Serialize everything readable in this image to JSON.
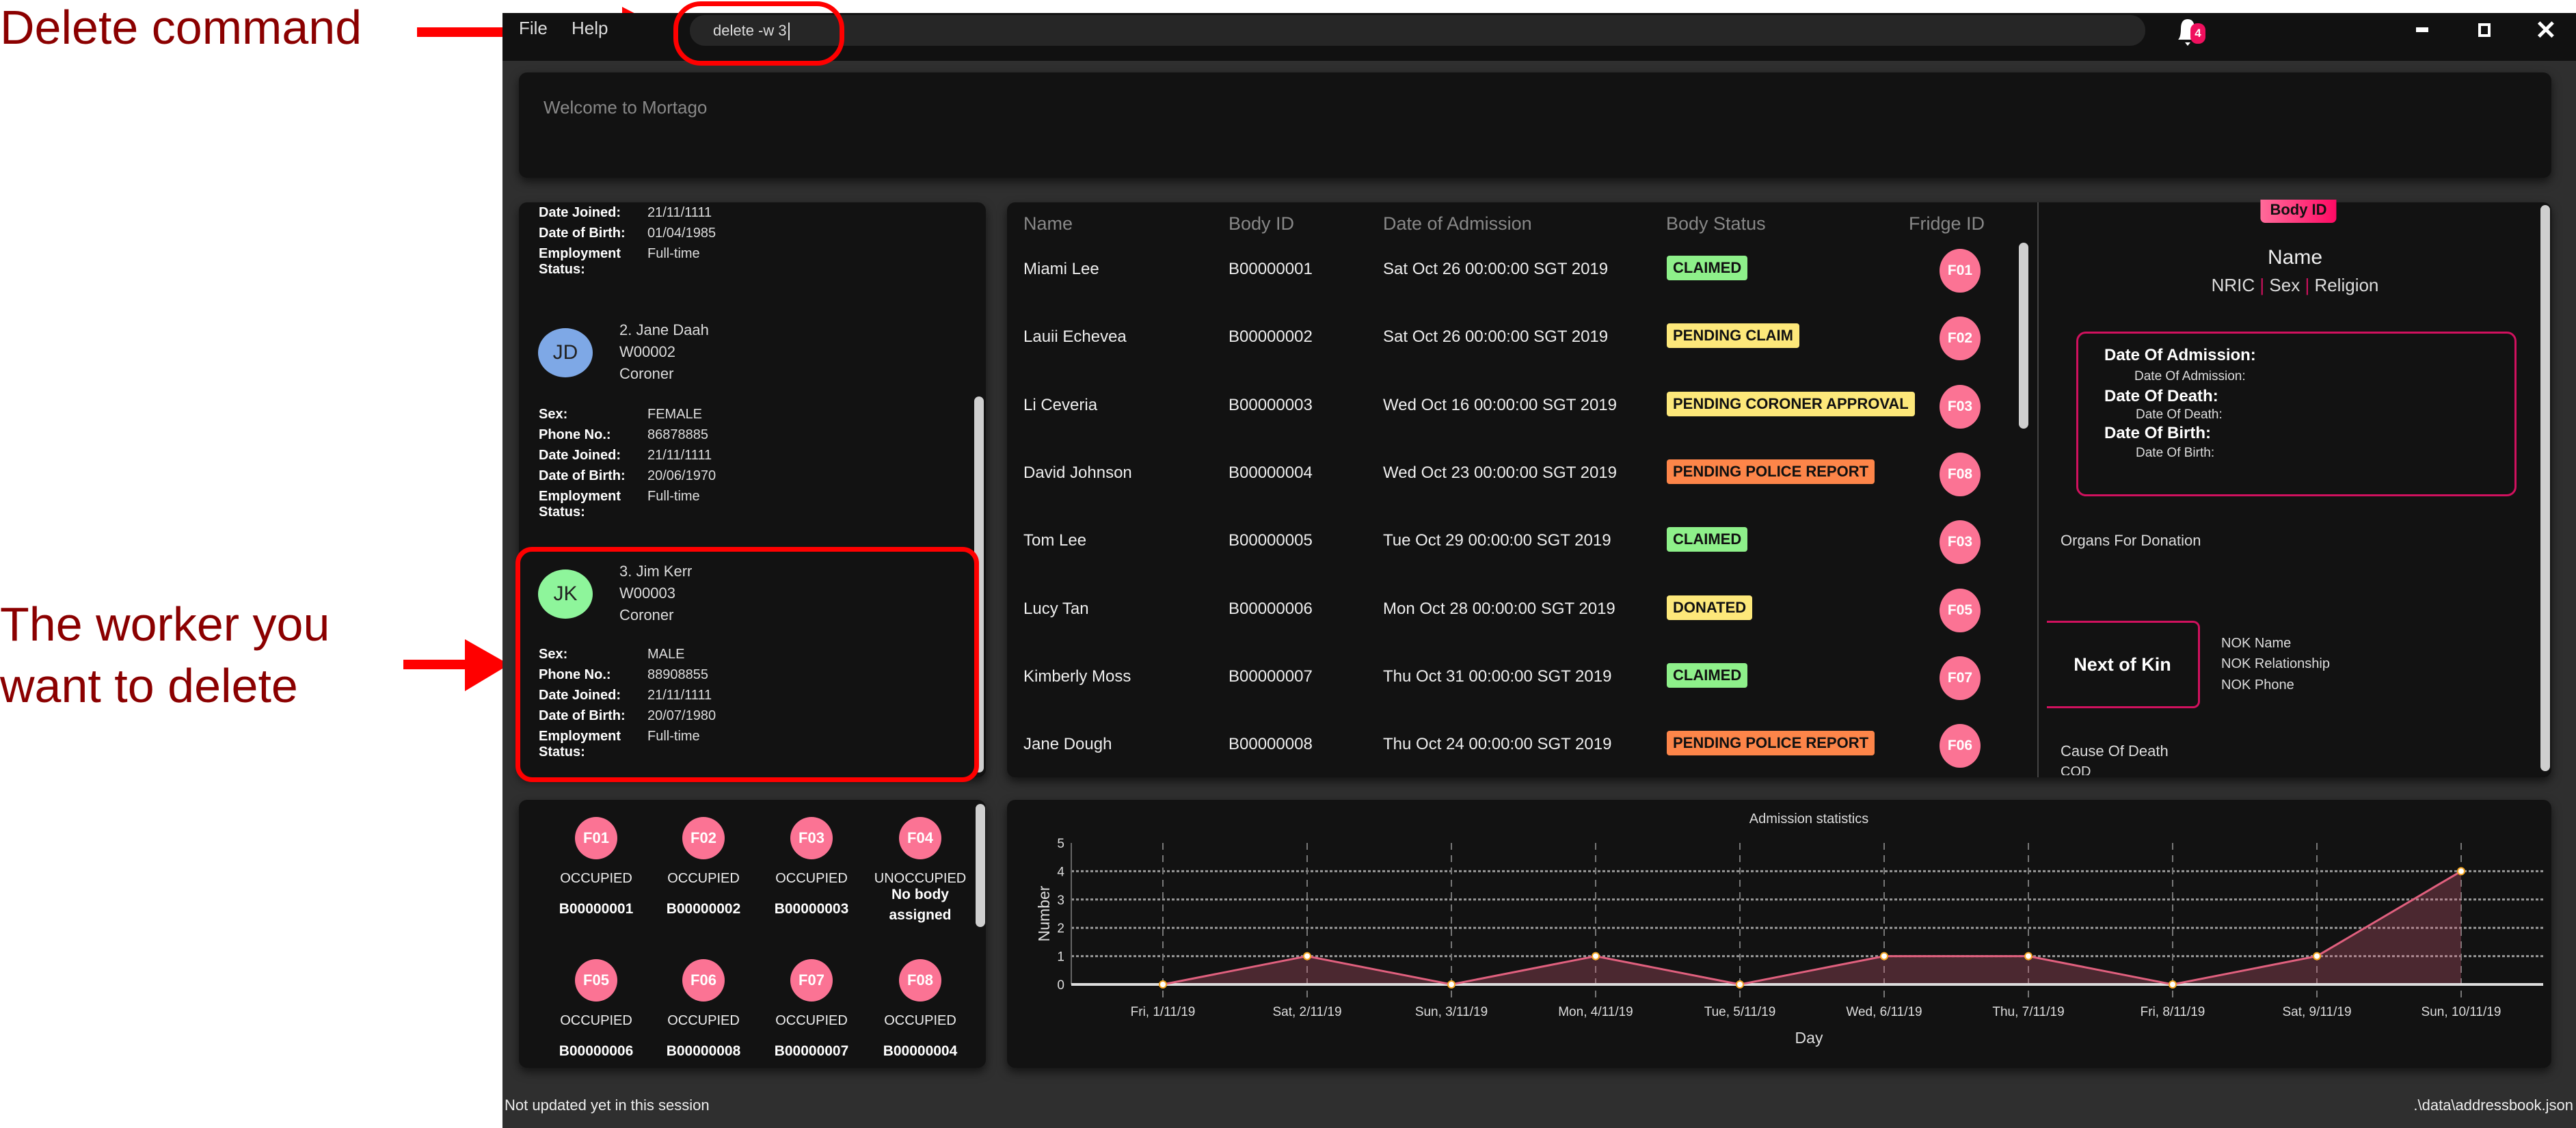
{
  "annotations": {
    "delete_command": "Delete command",
    "worker_line1": "The worker you",
    "worker_line2": "want to delete"
  },
  "menu": {
    "file": "File",
    "help": "Help"
  },
  "command_box": {
    "value": "delete -w 3"
  },
  "notifications": {
    "count": "4",
    "icon": "bell-icon"
  },
  "window_controls": {
    "minimize": "minimize-icon",
    "maximize": "maximize-icon",
    "close": "close-icon"
  },
  "result_display": {
    "text": "Welcome to Mortago"
  },
  "workers": {
    "labels": {
      "sex": "Sex:",
      "phone": "Phone No.:",
      "joined": "Date Joined:",
      "dob": "Date of Birth:",
      "employment": "Employment",
      "status": "Status:"
    },
    "partial": {
      "joined": "21/11/1111",
      "dob": "01/04/1985",
      "employment": "Full-time"
    },
    "items": [
      {
        "initials": "JD",
        "name": "2. Jane Daah",
        "id": "W00002",
        "designation": "Coroner",
        "sex": "FEMALE",
        "phone": "86878885",
        "joined": "21/11/1111",
        "dob": "20/06/1970",
        "employment": "Full-time",
        "color": "#7ea8e6"
      },
      {
        "initials": "JK",
        "name": "3. Jim Kerr",
        "id": "W00003",
        "designation": "Coroner",
        "sex": "MALE",
        "phone": "88908855",
        "joined": "21/11/1111",
        "dob": "20/07/1980",
        "employment": "Full-time",
        "color": "#8ef59b"
      }
    ]
  },
  "fridges": [
    {
      "id": "F01",
      "status": "OCCUPIED",
      "body": "B00000001"
    },
    {
      "id": "F02",
      "status": "OCCUPIED",
      "body": "B00000002"
    },
    {
      "id": "F03",
      "status": "OCCUPIED",
      "body": "B00000003"
    },
    {
      "id": "F04",
      "status": "UNOCCUPIED",
      "body": "No body assigned"
    },
    {
      "id": "F05",
      "status": "OCCUPIED",
      "body": "B00000006"
    },
    {
      "id": "F06",
      "status": "OCCUPIED",
      "body": "B00000008"
    },
    {
      "id": "F07",
      "status": "OCCUPIED",
      "body": "B00000007"
    },
    {
      "id": "F08",
      "status": "OCCUPIED",
      "body": "B00000004"
    }
  ],
  "bodies": {
    "headers": {
      "name": "Name",
      "id": "Body ID",
      "date": "Date of Admission",
      "status": "Body Status",
      "fridge": "Fridge ID"
    },
    "status_colors": {
      "CLAIMED": "#8ef08a",
      "PENDING CLAIM": "#fde87a",
      "PENDING CORONER APPROVAL": "#fde87a",
      "PENDING POLICE REPORT": "#fd8549",
      "DONATED": "#fde87a"
    },
    "rows": [
      {
        "name": "Miami Lee",
        "id": "B00000001",
        "date": "Sat Oct 26 00:00:00 SGT 2019",
        "status": "CLAIMED",
        "fridge": "F01"
      },
      {
        "name": "Lauii Echevea",
        "id": "B00000002",
        "date": "Sat Oct 26 00:00:00 SGT 2019",
        "status": "PENDING CLAIM",
        "fridge": "F02"
      },
      {
        "name": "Li Ceveria",
        "id": "B00000003",
        "date": "Wed Oct 16 00:00:00 SGT 2019",
        "status": "PENDING CORONER APPROVAL",
        "fridge": "F03"
      },
      {
        "name": "David Johnson",
        "id": "B00000004",
        "date": "Wed Oct 23 00:00:00 SGT 2019",
        "status": "PENDING POLICE REPORT",
        "fridge": "F08"
      },
      {
        "name": "Tom Lee",
        "id": "B00000005",
        "date": "Tue Oct 29 00:00:00 SGT 2019",
        "status": "CLAIMED",
        "fridge": "F03"
      },
      {
        "name": "Lucy Tan",
        "id": "B00000006",
        "date": "Mon Oct 28 00:00:00 SGT 2019",
        "status": "DONATED",
        "fridge": "F05"
      },
      {
        "name": "Kimberly Moss",
        "id": "B00000007",
        "date": "Thu Oct 31 00:00:00 SGT 2019",
        "status": "CLAIMED",
        "fridge": "F07"
      },
      {
        "name": "Jane Dough",
        "id": "B00000008",
        "date": "Thu Oct 24 00:00:00 SGT 2019",
        "status": "PENDING POLICE REPORT",
        "fridge": "F06"
      }
    ]
  },
  "body_detail": {
    "badge": "Body ID",
    "name": "Name",
    "nric": "NRIC",
    "sex": "Sex",
    "religion": "Religion",
    "separator": "|",
    "admission_label": "Date Of Admission:",
    "admission_value": "Date Of Admission:",
    "death_label": "Date Of Death:",
    "death_value": "Date Of Death:",
    "birth_label": "Date Of Birth:",
    "birth_value": "Date Of Birth:",
    "organs": "Organs For Donation",
    "nok_title": "Next of Kin",
    "nok_name": "NOK Name",
    "nok_relationship": "NOK Relationship",
    "nok_phone": "NOK Phone",
    "cause": "Cause Of Death",
    "cod": "COD"
  },
  "chart_data": {
    "type": "area",
    "title": "Admission statistics",
    "xlabel": "Day",
    "ylabel": "Number",
    "categories": [
      "Fri, 1/11/19",
      "Sat, 2/11/19",
      "Sun, 3/11/19",
      "Mon, 4/11/19",
      "Tue, 5/11/19",
      "Wed, 6/11/19",
      "Thu, 7/11/19",
      "Fri, 8/11/19",
      "Sat, 9/11/19",
      "Sun, 10/11/19"
    ],
    "values": [
      0,
      1,
      0,
      1,
      0,
      1,
      1,
      0,
      1,
      4
    ],
    "ylim": [
      0,
      5
    ],
    "yticks": [
      0,
      1,
      2,
      3,
      4,
      5
    ],
    "grid": true,
    "color": "#e0607e"
  },
  "status_bar": {
    "left": "Not updated yet in this session",
    "right": ".\\data\\addressbook.json"
  }
}
